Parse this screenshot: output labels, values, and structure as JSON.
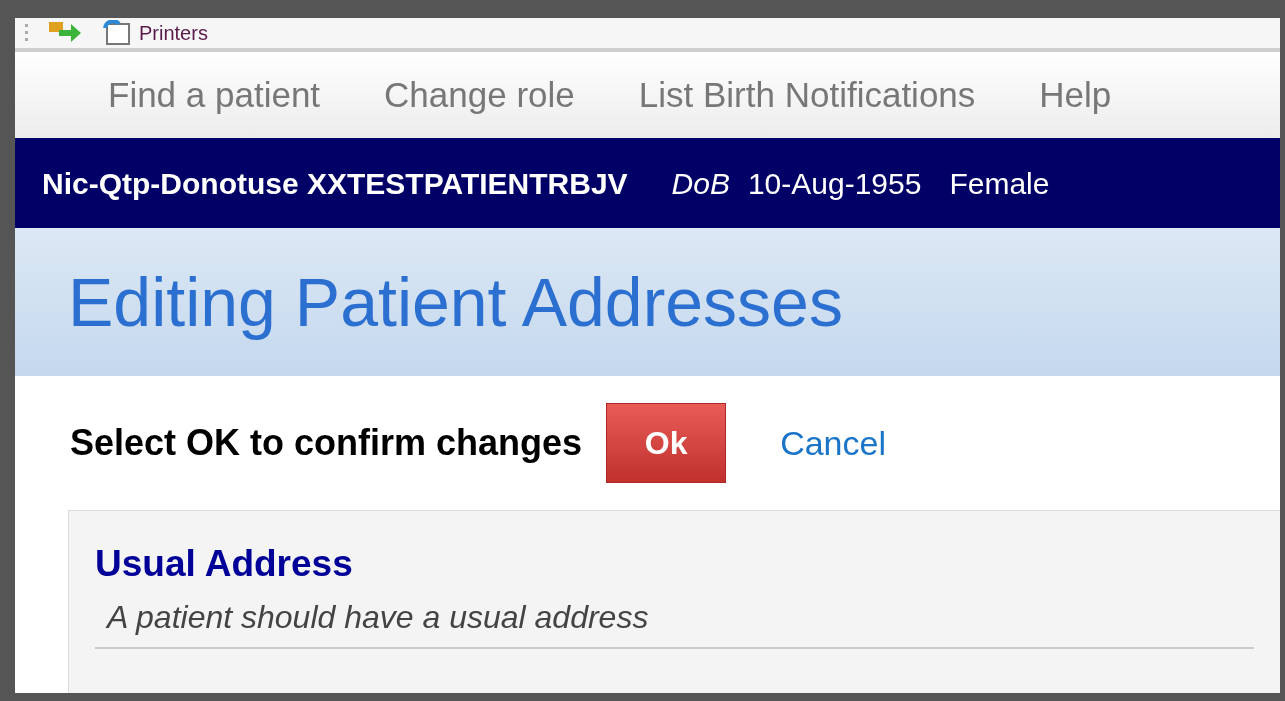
{
  "toolbar": {
    "items": [
      {
        "label": "Printers"
      }
    ]
  },
  "nav": {
    "items": [
      {
        "label": "Find a patient"
      },
      {
        "label": "Change role"
      },
      {
        "label": "List Birth Notifications"
      },
      {
        "label": "Help"
      }
    ]
  },
  "patient_banner": {
    "name": "Nic-Qtp-Donotuse XXTESTPATIENTRBJV",
    "dob_label": "DoB",
    "dob": "10-Aug-1955",
    "gender": "Female"
  },
  "page_title": "Editing Patient Addresses",
  "confirm": {
    "prompt": "Select OK to confirm changes",
    "ok": "Ok",
    "cancel": "Cancel"
  },
  "section": {
    "title": "Usual Address",
    "hint": "A patient should have a usual address"
  }
}
